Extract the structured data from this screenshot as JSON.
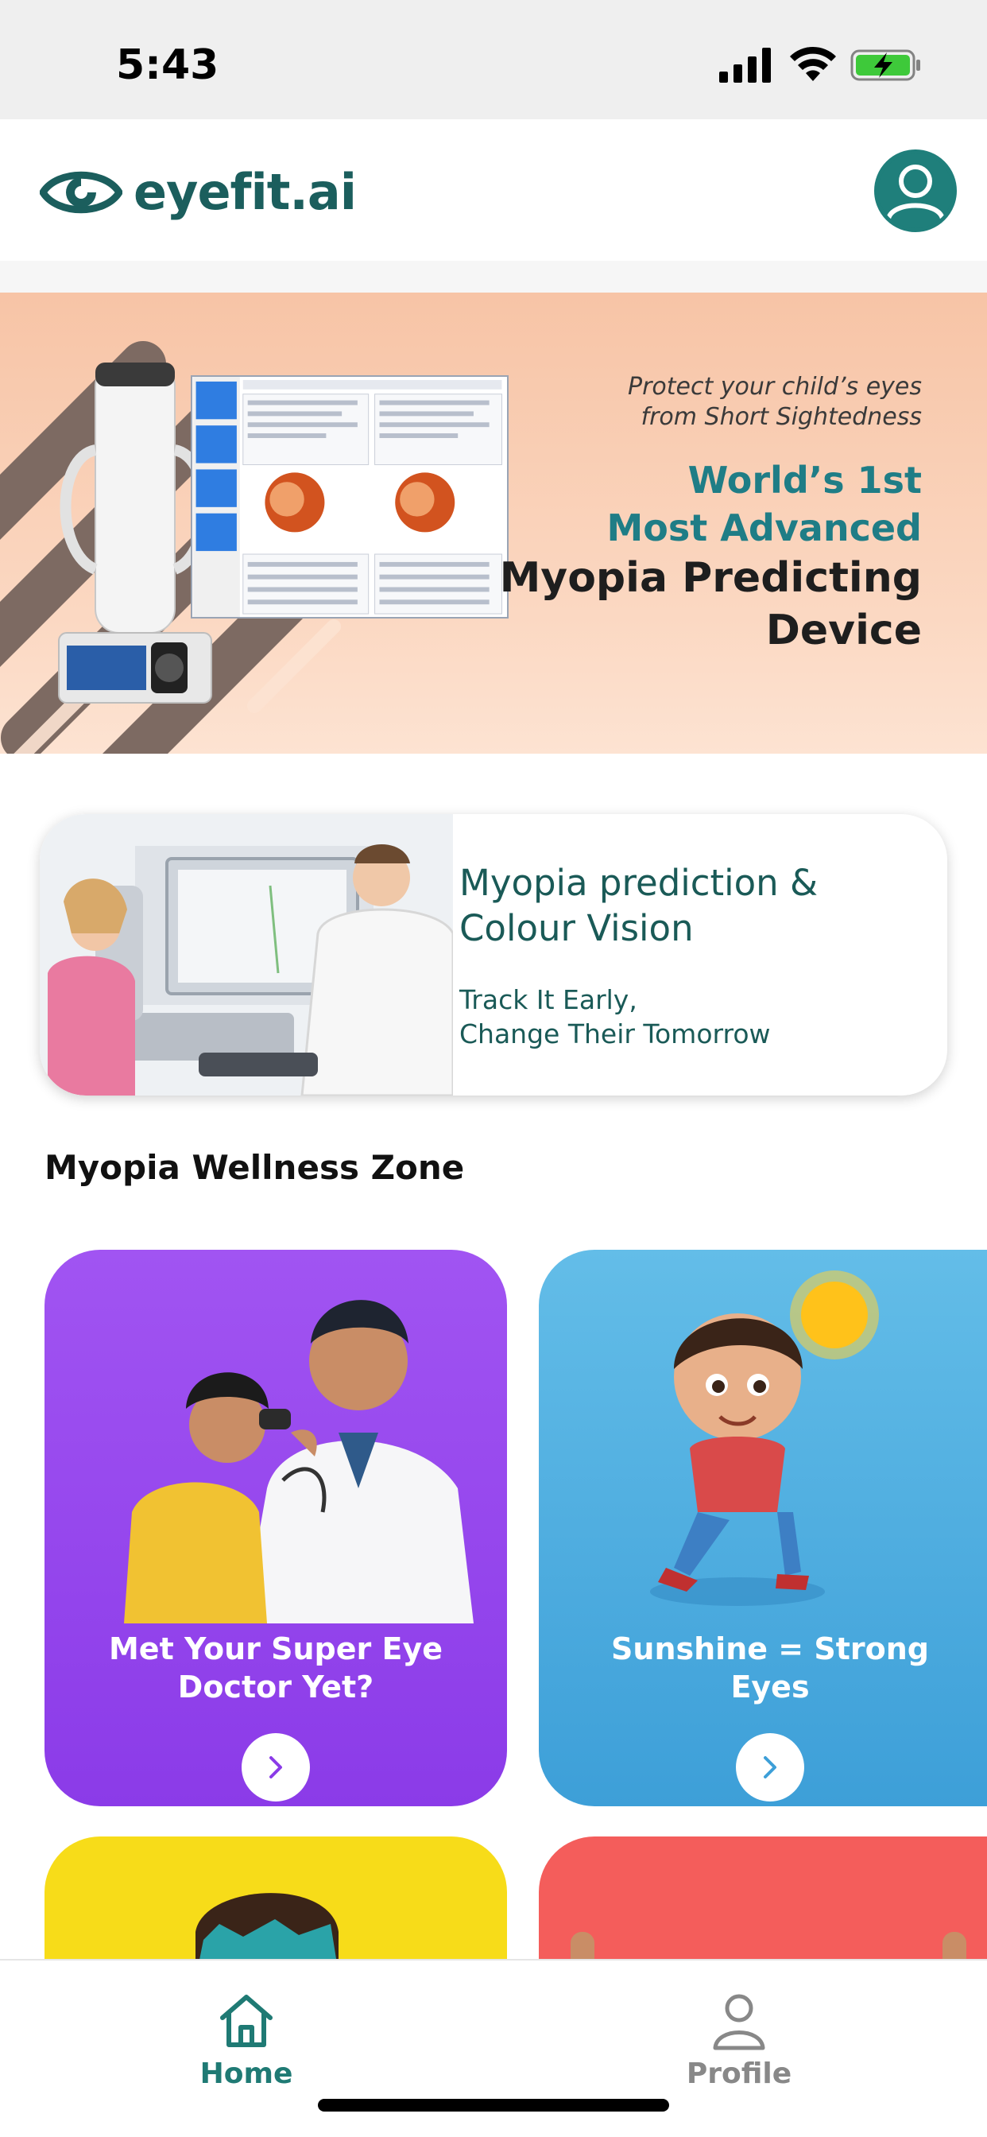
{
  "status_bar": {
    "time": "5:43",
    "icons": [
      "signal-icon",
      "wifi-icon",
      "battery-charging-icon"
    ]
  },
  "header": {
    "logo_text": "eyefit.ai",
    "logo_icon": "eye-logo-icon",
    "profile_icon": "user-avatar-icon"
  },
  "hero": {
    "tagline_line1": "Protect your child’s eyes",
    "tagline_line2": "from Short Sightedness",
    "headline_line1": "World’s 1st",
    "headline_line2": "Most Advanced",
    "headline_line3": "Myopia Predicting",
    "headline_line4": "Device"
  },
  "feature_card": {
    "title": "Myopia prediction & Colour Vision",
    "subtitle_line1": "Track It Early,",
    "subtitle_line2": "Change Their Tomorrow"
  },
  "wellness_zone": {
    "title": "Myopia Wellness Zone",
    "cards": [
      {
        "label_line1": "Met Your Super Eye",
        "label_line2": "Doctor Yet?",
        "color": "#8b3be8",
        "button_icon": "chevron-right-icon"
      },
      {
        "label_line1": "Sunshine = Strong",
        "label_line2": "Eyes",
        "color": "#3d9fd8",
        "button_icon": "chevron-right-icon"
      },
      {
        "color": "#f7dc19"
      },
      {
        "color": "#f45d5b"
      }
    ]
  },
  "bottom_nav": {
    "items": [
      {
        "label": "Home",
        "icon": "home-icon",
        "active": true
      },
      {
        "label": "Profile",
        "icon": "profile-icon",
        "active": false
      }
    ]
  },
  "colors": {
    "brand_teal": "#1b5e5d",
    "accent_teal": "#1f7d86",
    "hero_peach": "#f7c4a6"
  }
}
